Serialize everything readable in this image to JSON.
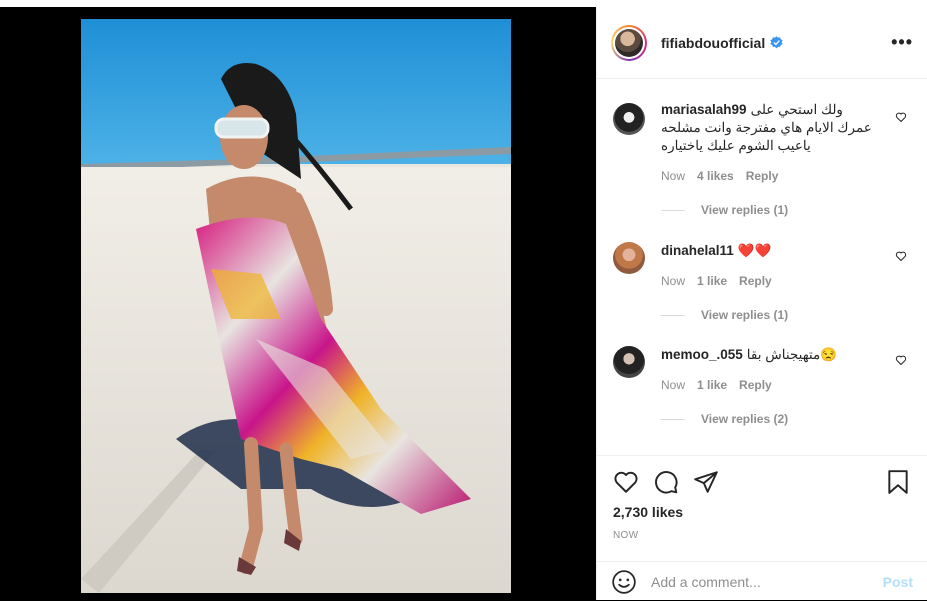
{
  "post": {
    "username": "fifiabdouofficial",
    "verified": true,
    "more_icon": "more-horizontal-icon",
    "likes_text": "2,730 likes",
    "date_text": "NOW"
  },
  "comments": [
    {
      "username": "mariasalah99",
      "text": "ولك استحي على عمرك الايام هاي مفترجة وانت مشلحه ياعيب الشوم عليك ياختياره",
      "time": "Now",
      "likes": "4 likes",
      "reply_label": "Reply",
      "view_replies": "View replies (1)"
    },
    {
      "username": "dinahelal11",
      "text": "❤️❤️",
      "time": "Now",
      "likes": "1 like",
      "reply_label": "Reply",
      "view_replies": "View replies (1)"
    },
    {
      "username": "memoo_.055",
      "text": "متهيجناش بقا😒",
      "time": "Now",
      "likes": "1 like",
      "reply_label": "Reply",
      "view_replies": "View replies (2)"
    }
  ],
  "composer": {
    "placeholder": "Add a comment...",
    "post_label": "Post"
  },
  "colors": {
    "verified_blue": "#3897f0",
    "post_button": "#b2dffc",
    "muted": "#8e8e8e"
  }
}
